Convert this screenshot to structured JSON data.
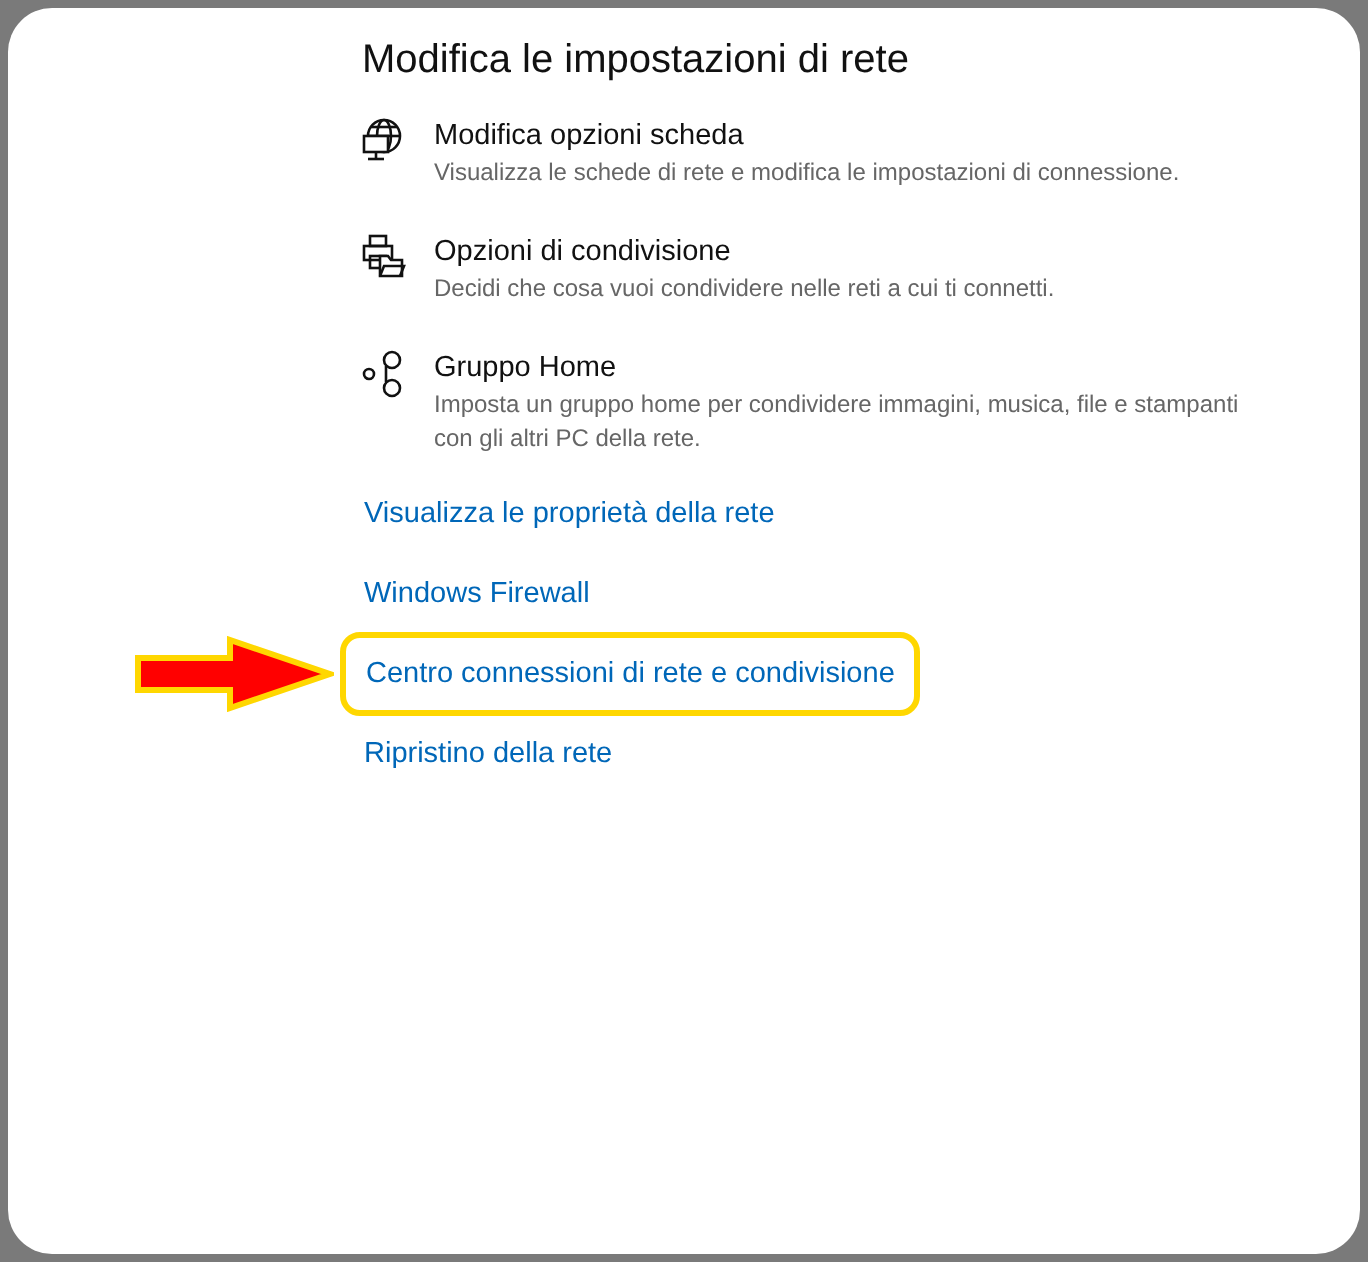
{
  "title": "Modifica le impostazioni di rete",
  "options": [
    {
      "kind": "adapter",
      "title": "Modifica opzioni scheda",
      "description": "Visualizza le schede di rete e modifica le impostazioni di connessione."
    },
    {
      "kind": "sharing",
      "title": "Opzioni di condivisione",
      "description": "Decidi che cosa vuoi condividere nelle reti a cui ti connetti."
    },
    {
      "kind": "homegroup",
      "title": "Gruppo Home",
      "description": "Imposta un gruppo home per condividere immagini, musica, file e stampanti con gli altri PC della rete."
    }
  ],
  "links": [
    {
      "label": "Visualizza le proprietà della rete",
      "highlighted": false
    },
    {
      "label": "Windows Firewall",
      "highlighted": false
    },
    {
      "label": "Centro connessioni di rete e condivisione",
      "highlighted": true
    },
    {
      "label": "Ripristino della rete",
      "highlighted": false
    }
  ]
}
